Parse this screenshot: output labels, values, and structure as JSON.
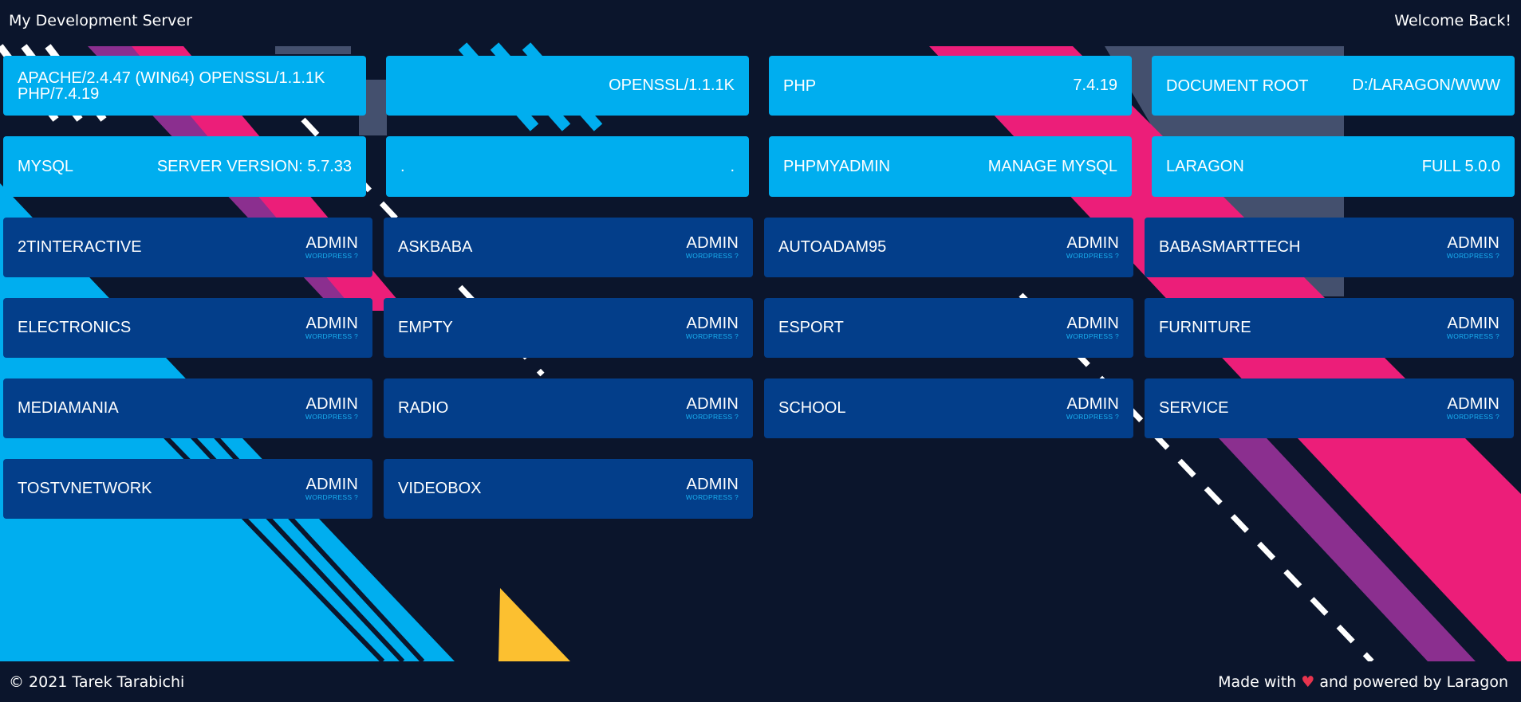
{
  "header": {
    "title": "My Development Server",
    "welcome": "Welcome Back!"
  },
  "info_tiles": [
    {
      "label": "APACHE/2.4.47 (WIN64) OPENSSL/1.1.1K PHP/7.4.19",
      "value": ""
    },
    {
      "label": "",
      "value": "OPENSSL/1.1.1K"
    },
    {
      "label": "PHP",
      "value": "7.4.19"
    },
    {
      "label": "DOCUMENT ROOT",
      "value": "D:/LARAGON/WWW"
    },
    {
      "label": "MYSQL",
      "value": "SERVER VERSION: 5.7.33"
    },
    {
      "label": ".",
      "value": "."
    },
    {
      "label": "PHPMYADMIN",
      "value": "MANAGE MYSQL"
    },
    {
      "label": "LARAGON",
      "value": "FULL 5.0.0"
    }
  ],
  "sites": [
    {
      "name": "2TINTERACTIVE",
      "action": "ADMIN",
      "hint": "WORDPRESS ?"
    },
    {
      "name": "ASKBABA",
      "action": "ADMIN",
      "hint": "WORDPRESS ?"
    },
    {
      "name": "AUTOADAM95",
      "action": "ADMIN",
      "hint": "WORDPRESS ?"
    },
    {
      "name": "BABASMARTTECH",
      "action": "ADMIN",
      "hint": "WORDPRESS ?"
    },
    {
      "name": "ELECTRONICS",
      "action": "ADMIN",
      "hint": "WORDPRESS ?"
    },
    {
      "name": "EMPTY",
      "action": "ADMIN",
      "hint": "WORDPRESS ?"
    },
    {
      "name": "ESPORT",
      "action": "ADMIN",
      "hint": "WORDPRESS ?"
    },
    {
      "name": "FURNITURE",
      "action": "ADMIN",
      "hint": "WORDPRESS ?"
    },
    {
      "name": "MEDIAMANIA",
      "action": "ADMIN",
      "hint": "WORDPRESS ?"
    },
    {
      "name": "RADIO",
      "action": "ADMIN",
      "hint": "WORDPRESS ?"
    },
    {
      "name": "SCHOOL",
      "action": "ADMIN",
      "hint": "WORDPRESS ?"
    },
    {
      "name": "SERVICE",
      "action": "ADMIN",
      "hint": "WORDPRESS ?"
    },
    {
      "name": "TOSTVNETWORK",
      "action": "ADMIN",
      "hint": "WORDPRESS ?"
    },
    {
      "name": "VIDEOBOX",
      "action": "ADMIN",
      "hint": "WORDPRESS ?"
    }
  ],
  "footer": {
    "copyright": "© 2021 Tarek Tarabichi",
    "made_with": "Made with",
    "heart": "♥",
    "powered_by": "and powered by Laragon"
  },
  "colors": {
    "background": "#0b152c",
    "info_tile": "#00aeef",
    "site_tile": "#033e8a",
    "pink": "#ec1e79",
    "purple": "#8b2f8f",
    "yellow": "#fcc030",
    "heart": "#e8344e"
  }
}
